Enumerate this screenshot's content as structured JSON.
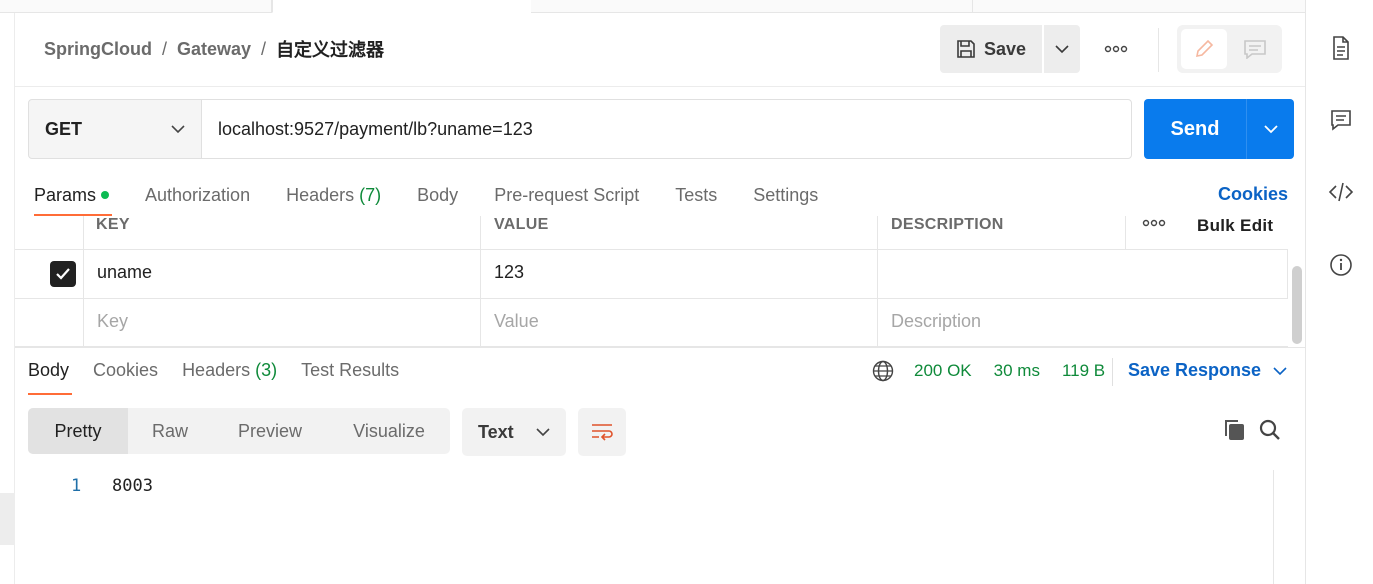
{
  "breadcrumb": {
    "collection": "SpringCloud",
    "folder": "Gateway",
    "request": "自定义过滤器",
    "separator": "/"
  },
  "header": {
    "save_label": "Save",
    "more_label": "ooo"
  },
  "request": {
    "method": "GET",
    "url": "localhost:9527/payment/lb?uname=123",
    "send_label": "Send"
  },
  "request_tabs": {
    "params": "Params",
    "authorization": "Authorization",
    "headers": "Headers",
    "headers_count": "(7)",
    "body": "Body",
    "prerequest": "Pre-request Script",
    "tests": "Tests",
    "settings": "Settings",
    "cookies": "Cookies"
  },
  "params_table": {
    "columns": {
      "key": "KEY",
      "value": "VALUE",
      "description": "DESCRIPTION",
      "more": "ooo",
      "bulk_edit": "Bulk Edit"
    },
    "rows": [
      {
        "key": "uname",
        "value": "123",
        "description": "",
        "checked": true
      }
    ],
    "placeholders": {
      "key": "Key",
      "value": "Value",
      "description": "Description"
    }
  },
  "response_tabs": {
    "body": "Body",
    "cookies": "Cookies",
    "headers": "Headers",
    "headers_count": "(3)",
    "test_results": "Test Results"
  },
  "response_status": {
    "status": "200 OK",
    "time": "30 ms",
    "size": "119 B",
    "save_response": "Save Response"
  },
  "view_modes": {
    "pretty": "Pretty",
    "raw": "Raw",
    "preview": "Preview",
    "visualize": "Visualize",
    "format": "Text"
  },
  "response_body": {
    "line_number": "1",
    "content": "8003"
  },
  "colors": {
    "accent": "#097bed",
    "tab_underline": "#ff6c37",
    "status_green": "#0f8a3a",
    "link_blue": "#0b63c5"
  }
}
